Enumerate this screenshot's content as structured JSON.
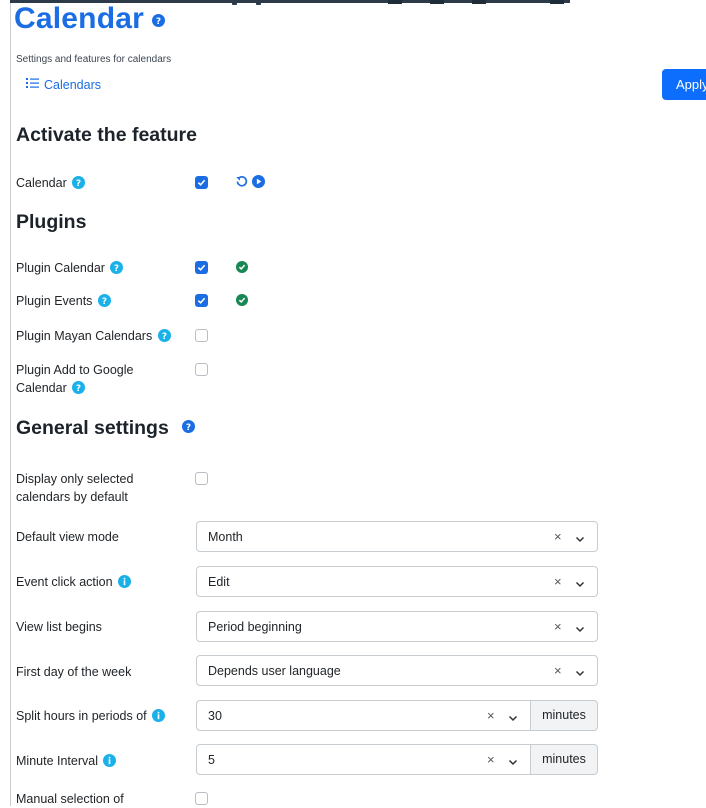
{
  "page": {
    "title": "Calendar",
    "subtitle": "Settings and features for calendars",
    "breadcrumb_label": "Calendars",
    "apply_label": "Apply"
  },
  "colors": {
    "accent": "#1a6de3",
    "apply_button": "#0d6efd",
    "success": "#198754",
    "info_badge": "#1ab0e8"
  },
  "sections": {
    "activate": {
      "heading": "Activate the feature",
      "rows": [
        {
          "label": "Calendar",
          "help_icon": "question-icon",
          "checked": true
        }
      ]
    },
    "plugins": {
      "heading": "Plugins",
      "rows": [
        {
          "label": "Plugin Calendar",
          "help_icon": "question-icon",
          "checked": true,
          "status": "check-circle-icon"
        },
        {
          "label": "Plugin Events",
          "help_icon": "question-icon",
          "checked": true,
          "status": "check-circle-icon"
        },
        {
          "label": "Plugin Mayan Calendars",
          "help_icon": "question-icon",
          "checked": false
        },
        {
          "label_line1": "Plugin Add to Google",
          "label_line2": "Calendar",
          "help_icon": "question-icon",
          "checked": false
        }
      ]
    },
    "general": {
      "heading": "General settings",
      "display_selected": {
        "label_line1": "Display only selected",
        "label_line2": "calendars by default",
        "checked": false
      },
      "default_view": {
        "label": "Default view mode",
        "value": "Month"
      },
      "event_click": {
        "label": "Event click action",
        "value": "Edit",
        "help_icon": "info-icon"
      },
      "view_list": {
        "label": "View list begins",
        "value": "Period beginning"
      },
      "first_day": {
        "label": "First day of the week",
        "value": "Depends user language"
      },
      "split_hours": {
        "label": "Split hours in periods of",
        "value": "30",
        "unit": "minutes",
        "help_icon": "info-icon"
      },
      "minute_interval": {
        "label": "Minute Interval",
        "value": "5",
        "unit": "minutes",
        "help_icon": "info-icon"
      },
      "manual_selection": {
        "label": "Manual selection of",
        "checked": false
      }
    }
  }
}
